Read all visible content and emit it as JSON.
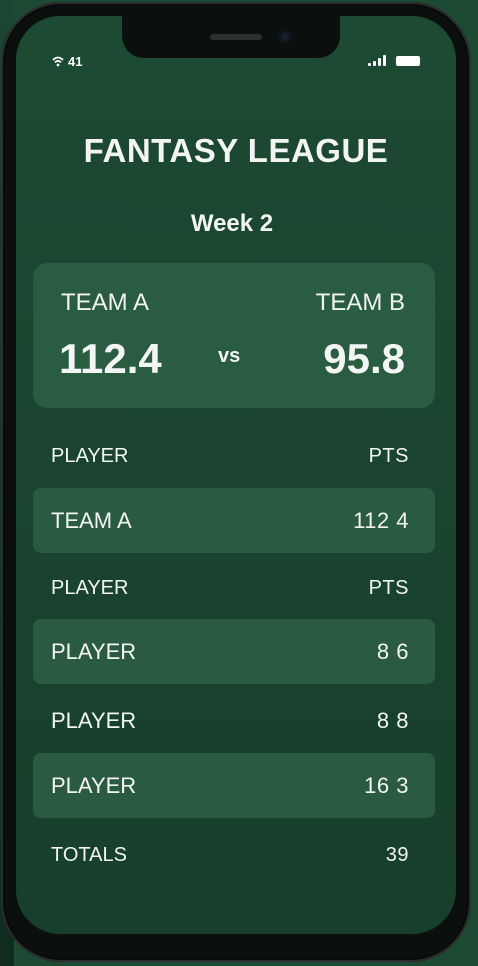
{
  "status": {
    "signal_text": "41"
  },
  "header": {
    "title": "FANTASY LEAGUE",
    "week": "Week 2"
  },
  "matchup": {
    "team_a": {
      "name": "TEAM A",
      "score": "112.4"
    },
    "vs": "vs",
    "team_b": {
      "name": "TEAM B",
      "score": "95.8"
    }
  },
  "rows": [
    {
      "label": "PLAYER",
      "value": "PTS"
    },
    {
      "label": "TEAM A",
      "value": "112 4"
    },
    {
      "label": "PLAYER",
      "value": "PTS"
    },
    {
      "label": "PLAYER",
      "value": "8 6"
    },
    {
      "label": "PLAYER",
      "value": "8 8"
    },
    {
      "label": "PLAYER",
      "value": "16 3"
    },
    {
      "label": "TOTALS",
      "value": "39"
    }
  ],
  "colors": {
    "background": "#1d4a33",
    "card": "#2a5c41",
    "text": "#ffffff"
  }
}
